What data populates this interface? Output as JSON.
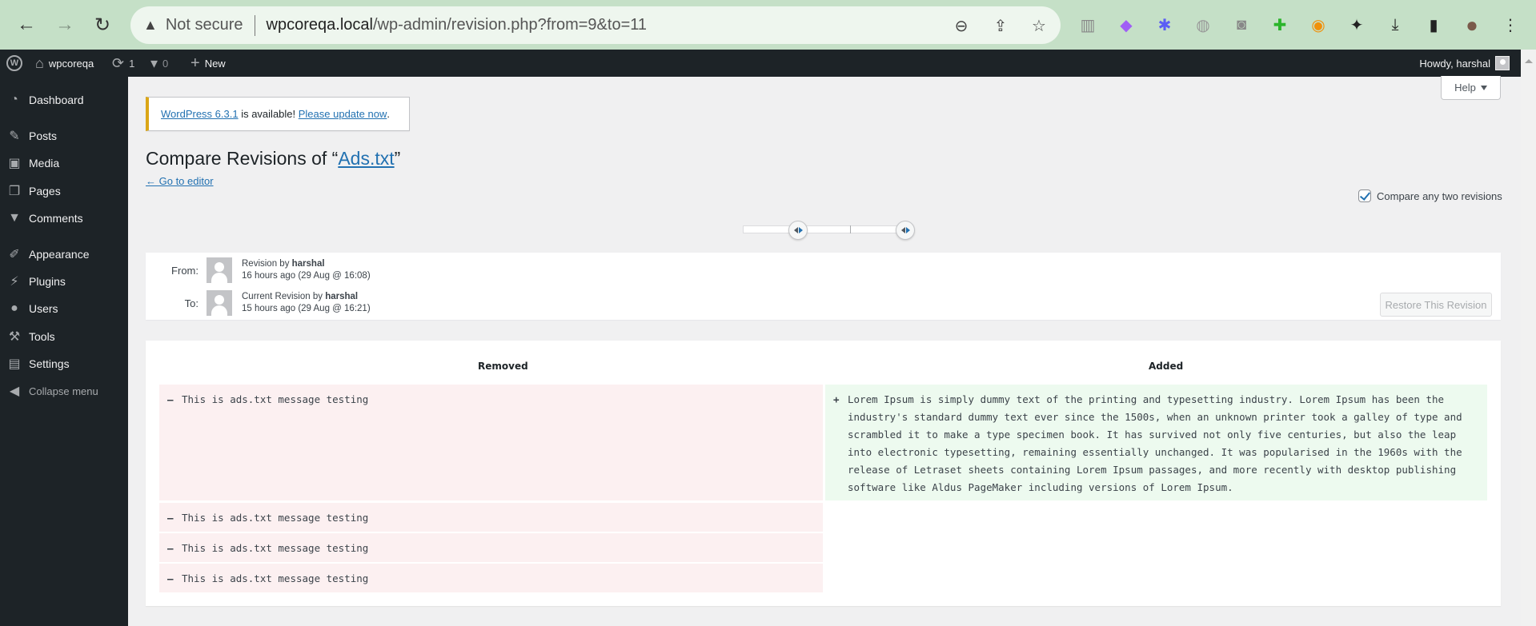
{
  "browser": {
    "back_icon": "←",
    "forward_icon": "→",
    "reload_icon": "↻",
    "security_icon": "▲",
    "security_label": "Not secure",
    "url_host": "wpcoreqa.local",
    "url_path": "/wp-admin/revision.php?from=9&to=11",
    "zoom_icon": "⊖",
    "share_icon": "⇪",
    "bookmark_icon": "☆",
    "extensions": [
      "▥",
      "◆",
      "✱",
      "◍",
      "◙",
      "✚",
      "◉",
      "✦",
      "⤓",
      "▮",
      "●",
      "⋮"
    ]
  },
  "adminbar": {
    "wp_logo": "W",
    "site_name": "wpcoreqa",
    "updates_count": "1",
    "comments_count": "0",
    "new_label": "New",
    "howdy": "Howdy, harshal"
  },
  "sidebar": {
    "items": [
      {
        "label": "Dashboard",
        "icon": "◔"
      },
      {
        "label": "Posts",
        "icon": "✎"
      },
      {
        "label": "Media",
        "icon": "▣"
      },
      {
        "label": "Pages",
        "icon": "❐"
      },
      {
        "label": "Comments",
        "icon": "▼"
      },
      {
        "label": "Appearance",
        "icon": "✐"
      },
      {
        "label": "Plugins",
        "icon": "⚡"
      },
      {
        "label": "Users",
        "icon": "●"
      },
      {
        "label": "Tools",
        "icon": "⚒"
      },
      {
        "label": "Settings",
        "icon": "▤"
      },
      {
        "label": "Collapse menu",
        "icon": "◀"
      }
    ]
  },
  "help": {
    "label": "Help"
  },
  "notice": {
    "version_link": "WordPress 6.3.1",
    "middle_text": " is available! ",
    "update_link": "Please update now",
    "end_text": "."
  },
  "page": {
    "title_prefix": "Compare Revisions of “",
    "title_link": "Ads.txt",
    "title_suffix": "”",
    "goto_editor": "← Go to editor",
    "compare_two_label": "Compare any two revisions",
    "compare_two_checked": true
  },
  "slider": {
    "from_revision": 9,
    "to_revision": 11
  },
  "meta": {
    "from": {
      "label": "From:",
      "byline_prefix": "Revision by ",
      "author": "harshal",
      "time": "16 hours ago (29 Aug @ 16:08)"
    },
    "to": {
      "label": "To:",
      "byline_prefix": "Current Revision by ",
      "author": "harshal",
      "time": "15 hours ago (29 Aug @ 16:21)"
    },
    "restore_label": "Restore This Revision"
  },
  "diff": {
    "removed_header": "Removed",
    "added_header": "Added",
    "removed_sign": "–",
    "added_sign": "+",
    "removed_lines": [
      "This is ads.txt message testing",
      "This is ads.txt message testing",
      "This is ads.txt message testing",
      "This is ads.txt message testing"
    ],
    "added_lines": [
      "Lorem Ipsum is simply dummy text of the printing and typesetting industry. Lorem Ipsum has been the industry's standard dummy text ever since the 1500s, when an unknown printer took a galley of type and scrambled it to make a type specimen book. It has survived not only five centuries, but also the leap into electronic typesetting, remaining essentially unchanged. It was popularised in the 1960s with the release of Letraset sheets containing Lorem Ipsum passages, and more recently with desktop publishing software like Aldus PageMaker including versions of Lorem Ipsum."
    ]
  }
}
